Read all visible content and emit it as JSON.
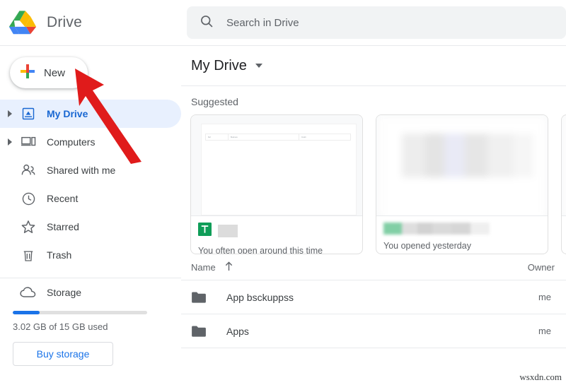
{
  "app": {
    "brand_title": "Drive",
    "logo_icon": "google-drive-logo",
    "watermark": "wsxdn.com"
  },
  "sidebar": {
    "new_button": {
      "label": "New",
      "icon": "google-plus-icon"
    },
    "items": [
      {
        "label": "My Drive",
        "icon": "drive-icon",
        "active": true,
        "expandable": true
      },
      {
        "label": "Computers",
        "icon": "computer-icon",
        "active": false,
        "expandable": true
      },
      {
        "label": "Shared with me",
        "icon": "people-icon",
        "active": false,
        "expandable": false
      },
      {
        "label": "Recent",
        "icon": "clock-icon",
        "active": false,
        "expandable": false
      },
      {
        "label": "Starred",
        "icon": "star-icon",
        "active": false,
        "expandable": false
      },
      {
        "label": "Trash",
        "icon": "trash-icon",
        "active": false,
        "expandable": false
      }
    ],
    "storage": {
      "label": "Storage",
      "icon": "cloud-icon",
      "used_text": "3.02 GB of 15 GB used",
      "used_percent": 20,
      "buy_label": "Buy storage",
      "fill_color": "#1a73e8"
    }
  },
  "search": {
    "placeholder": "Search in Drive",
    "icon": "search-icon"
  },
  "breadcrumb": {
    "title": "My Drive",
    "caret_icon": "chevron-down-icon"
  },
  "suggested": {
    "heading": "Suggested",
    "cards": [
      {
        "caption": "You often open around this time",
        "file_icon": "google-sheets-icon",
        "name_blurred": true,
        "thumb_type": "spreadsheet",
        "sheet_cells": [
          "Ref",
          "Business",
          "Credit"
        ]
      },
      {
        "caption": "You opened yesterday",
        "file_icon": "blurred-icon",
        "name_blurred": true,
        "thumb_type": "blurred"
      },
      {
        "caption": "",
        "file_icon": "blurred-icon",
        "name_blurred": true,
        "thumb_type": "blurred"
      }
    ]
  },
  "file_list": {
    "columns": {
      "name": "Name",
      "owner": "Owner"
    },
    "sort_icon": "arrow-up-icon",
    "rows": [
      {
        "name": "App bsckuppss",
        "owner": "me",
        "icon": "folder-icon"
      },
      {
        "name": "Apps",
        "owner": "me",
        "icon": "folder-icon"
      }
    ]
  },
  "annotation": {
    "arrow_icon": "red-arrow-pointer",
    "arrow_color": "#e01b1b"
  }
}
